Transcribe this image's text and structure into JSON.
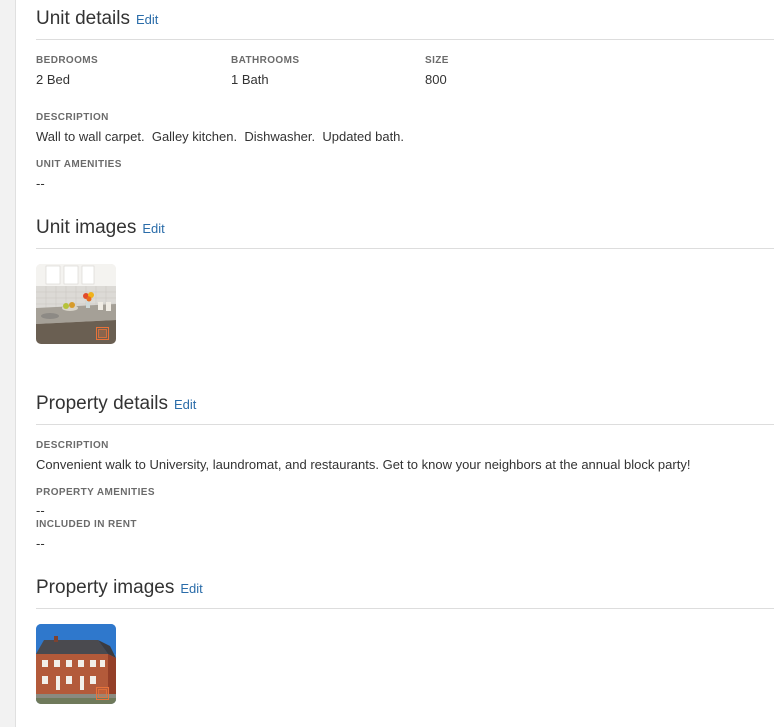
{
  "unit_details": {
    "title": "Unit details",
    "edit_label": "Edit",
    "bedrooms": {
      "label": "BEDROOMS",
      "value": "2 Bed"
    },
    "bathrooms": {
      "label": "BATHROOMS",
      "value": "1 Bath"
    },
    "size": {
      "label": "SIZE",
      "value": "800"
    },
    "description": {
      "label": "DESCRIPTION",
      "value": "Wall to wall carpet.  Galley kitchen.  Dishwasher.  Updated bath."
    },
    "amenities": {
      "label": "UNIT AMENITIES",
      "value": "--"
    }
  },
  "unit_images": {
    "title": "Unit images",
    "edit_label": "Edit",
    "images": [
      {
        "subject": "kitchen-photo",
        "badge_icon": "image-badge-icon"
      }
    ]
  },
  "property_details": {
    "title": "Property details",
    "edit_label": "Edit",
    "description": {
      "label": "DESCRIPTION",
      "value": "Convenient walk to University, laundromat, and restaurants. Get to know your neighbors at the annual block party!"
    },
    "amenities": {
      "label": "PROPERTY AMENITIES",
      "value": "--"
    },
    "included_in_rent": {
      "label": "INCLUDED IN RENT",
      "value": "--"
    }
  },
  "property_images": {
    "title": "Property images",
    "edit_label": "Edit",
    "images": [
      {
        "subject": "building-photo",
        "badge_icon": "image-badge-icon"
      }
    ]
  },
  "colors": {
    "link": "#2a6ca9",
    "label": "#6b6b6b",
    "text": "#333333",
    "badge": "#e8733a"
  }
}
